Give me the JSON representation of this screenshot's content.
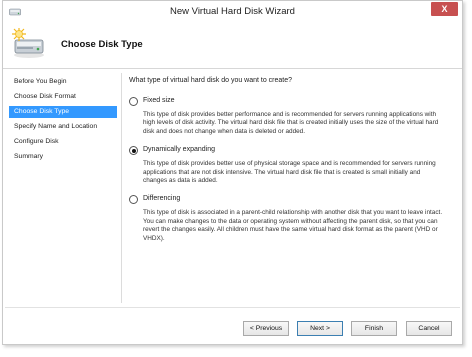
{
  "window": {
    "title": "New Virtual Hard Disk Wizard",
    "close_glyph": "X"
  },
  "header": {
    "title": "Choose Disk Type"
  },
  "sidebar": {
    "items": [
      {
        "label": "Before You Begin",
        "active": false
      },
      {
        "label": "Choose Disk Format",
        "active": false
      },
      {
        "label": "Choose Disk Type",
        "active": true
      },
      {
        "label": "Specify Name and Location",
        "active": false
      },
      {
        "label": "Configure Disk",
        "active": false
      },
      {
        "label": "Summary",
        "active": false
      }
    ]
  },
  "content": {
    "question": "What type of virtual hard disk do you want to create?",
    "options": [
      {
        "label": "Fixed size",
        "selected": false,
        "description": "This type of disk provides better performance and is recommended for servers running applications with high levels of disk activity. The virtual hard disk file that is created initially uses the size of the virtual hard disk and does not change when data is deleted or added."
      },
      {
        "label": "Dynamically expanding",
        "selected": true,
        "description": "This type of disk provides better use of physical storage space and is recommended for servers running applications that are not disk intensive. The virtual hard disk file that is created is small initially and changes as data is added."
      },
      {
        "label": "Differencing",
        "selected": false,
        "description": "This type of disk is associated in a parent-child relationship with another disk that you want to leave intact. You can make changes to the data or operating system without affecting the parent disk, so that you can revert the changes easily. All children must have the same virtual hard disk format as the parent (VHD or VHDX)."
      }
    ]
  },
  "buttons": {
    "previous": "< Previous",
    "next": "Next >",
    "finish": "Finish",
    "cancel": "Cancel"
  },
  "colors": {
    "selection": "#3399ff",
    "close_button": "#c75050"
  },
  "icons": {
    "app": "disk-icon",
    "header": "new-disk-icon",
    "close": "close-icon"
  }
}
